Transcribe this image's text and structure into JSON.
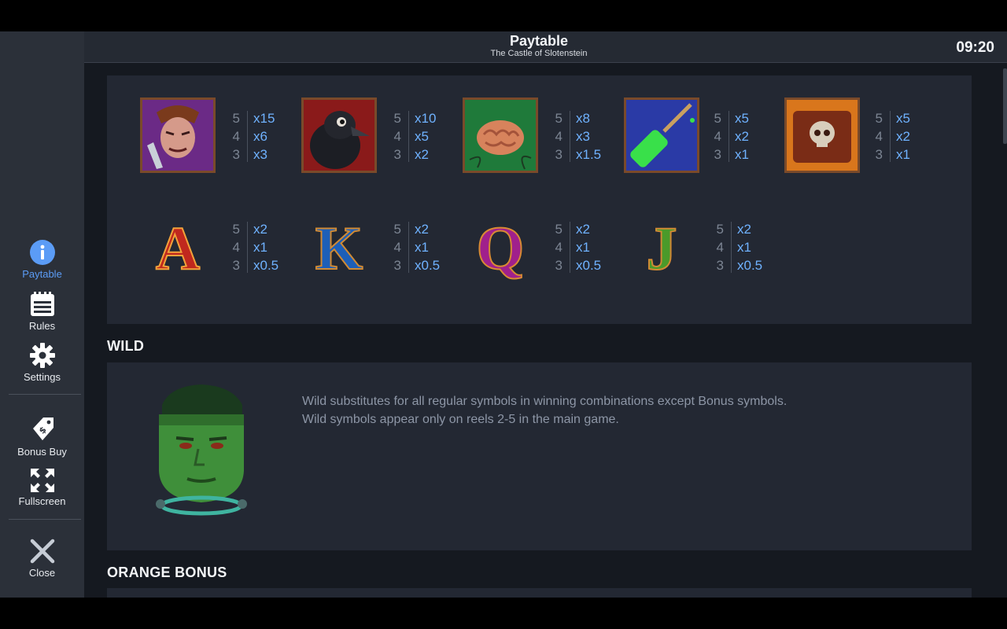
{
  "header": {
    "title": "Paytable",
    "subtitle": "The Castle of Slotenstein",
    "clock": "09:20"
  },
  "sidebar": {
    "items": [
      {
        "label": "Paytable",
        "icon": "info-icon"
      },
      {
        "label": "Rules",
        "icon": "notepad-icon"
      },
      {
        "label": "Settings",
        "icon": "gear-icon"
      },
      {
        "label": "Bonus Buy",
        "icon": "price-tag-icon"
      },
      {
        "label": "Fullscreen",
        "icon": "expand-arrows-icon"
      },
      {
        "label": "Close",
        "icon": "close-icon"
      }
    ]
  },
  "paytable": {
    "symbols": [
      {
        "symbol": "villain",
        "pays": [
          {
            "count": "5",
            "mult": "x15"
          },
          {
            "count": "4",
            "mult": "x6"
          },
          {
            "count": "3",
            "mult": "x3"
          }
        ]
      },
      {
        "symbol": "raven",
        "pays": [
          {
            "count": "5",
            "mult": "x10"
          },
          {
            "count": "4",
            "mult": "x5"
          },
          {
            "count": "3",
            "mult": "x2"
          }
        ]
      },
      {
        "symbol": "brain",
        "pays": [
          {
            "count": "5",
            "mult": "x8"
          },
          {
            "count": "4",
            "mult": "x3"
          },
          {
            "count": "3",
            "mult": "x1.5"
          }
        ]
      },
      {
        "symbol": "syringe",
        "pays": [
          {
            "count": "5",
            "mult": "x5"
          },
          {
            "count": "4",
            "mult": "x2"
          },
          {
            "count": "3",
            "mult": "x1"
          }
        ]
      },
      {
        "symbol": "skull-book",
        "pays": [
          {
            "count": "5",
            "mult": "x5"
          },
          {
            "count": "4",
            "mult": "x2"
          },
          {
            "count": "3",
            "mult": "x1"
          }
        ]
      },
      {
        "letter": "A",
        "pays": [
          {
            "count": "5",
            "mult": "x2"
          },
          {
            "count": "4",
            "mult": "x1"
          },
          {
            "count": "3",
            "mult": "x0.5"
          }
        ]
      },
      {
        "letter": "K",
        "pays": [
          {
            "count": "5",
            "mult": "x2"
          },
          {
            "count": "4",
            "mult": "x1"
          },
          {
            "count": "3",
            "mult": "x0.5"
          }
        ]
      },
      {
        "letter": "Q",
        "pays": [
          {
            "count": "5",
            "mult": "x2"
          },
          {
            "count": "4",
            "mult": "x1"
          },
          {
            "count": "3",
            "mult": "x0.5"
          }
        ]
      },
      {
        "letter": "J",
        "pays": [
          {
            "count": "5",
            "mult": "x2"
          },
          {
            "count": "4",
            "mult": "x1"
          },
          {
            "count": "3",
            "mult": "x0.5"
          }
        ]
      }
    ]
  },
  "wild": {
    "title": "WILD",
    "line1": "Wild substitutes for all regular symbols in winning combinations except Bonus symbols.",
    "line2": "Wild symbols appear only on reels 2-5 in the main game."
  },
  "orange_bonus": {
    "title": "ORANGE BONUS"
  },
  "colors": {
    "accent": "#5b9cf6",
    "multiplier": "#6fb2ff",
    "panel": "#232833",
    "sidebar": "#2b3039"
  }
}
